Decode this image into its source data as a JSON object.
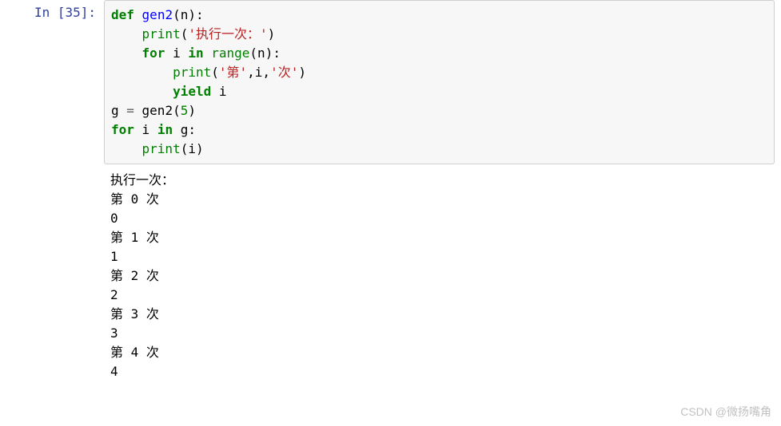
{
  "prompt": {
    "label": "In  [35]:"
  },
  "code": {
    "tokens": [
      {
        "cls": "kw",
        "t": "def"
      },
      {
        "cls": "txt",
        "t": " "
      },
      {
        "cls": "fn",
        "t": "gen2"
      },
      {
        "cls": "txt",
        "t": "(n):\n"
      },
      {
        "cls": "txt",
        "t": "    "
      },
      {
        "cls": "builtin",
        "t": "print"
      },
      {
        "cls": "txt",
        "t": "("
      },
      {
        "cls": "str",
        "t": "'执行一次：'"
      },
      {
        "cls": "txt",
        "t": ")\n"
      },
      {
        "cls": "txt",
        "t": "    "
      },
      {
        "cls": "kw",
        "t": "for"
      },
      {
        "cls": "txt",
        "t": " i "
      },
      {
        "cls": "kw",
        "t": "in"
      },
      {
        "cls": "txt",
        "t": " "
      },
      {
        "cls": "builtin",
        "t": "range"
      },
      {
        "cls": "txt",
        "t": "(n):\n"
      },
      {
        "cls": "txt",
        "t": "        "
      },
      {
        "cls": "builtin",
        "t": "print"
      },
      {
        "cls": "txt",
        "t": "("
      },
      {
        "cls": "str",
        "t": "'第'"
      },
      {
        "cls": "txt",
        "t": ",i,"
      },
      {
        "cls": "str",
        "t": "'次'"
      },
      {
        "cls": "txt",
        "t": ")\n"
      },
      {
        "cls": "txt",
        "t": "        "
      },
      {
        "cls": "kw",
        "t": "yield"
      },
      {
        "cls": "txt",
        "t": " i\n"
      },
      {
        "cls": "txt",
        "t": "g "
      },
      {
        "cls": "op",
        "t": "="
      },
      {
        "cls": "txt",
        "t": " gen2("
      },
      {
        "cls": "num",
        "t": "5"
      },
      {
        "cls": "txt",
        "t": ")\n"
      },
      {
        "cls": "kw",
        "t": "for"
      },
      {
        "cls": "txt",
        "t": " i "
      },
      {
        "cls": "kw",
        "t": "in"
      },
      {
        "cls": "txt",
        "t": " g:\n"
      },
      {
        "cls": "txt",
        "t": "    "
      },
      {
        "cls": "builtin",
        "t": "print"
      },
      {
        "cls": "txt",
        "t": "(i)"
      }
    ]
  },
  "output": {
    "lines": [
      "执行一次：",
      "第 0 次",
      "0",
      "第 1 次",
      "1",
      "第 2 次",
      "2",
      "第 3 次",
      "3",
      "第 4 次",
      "4"
    ]
  },
  "watermark": "CSDN @微扬嘴角"
}
